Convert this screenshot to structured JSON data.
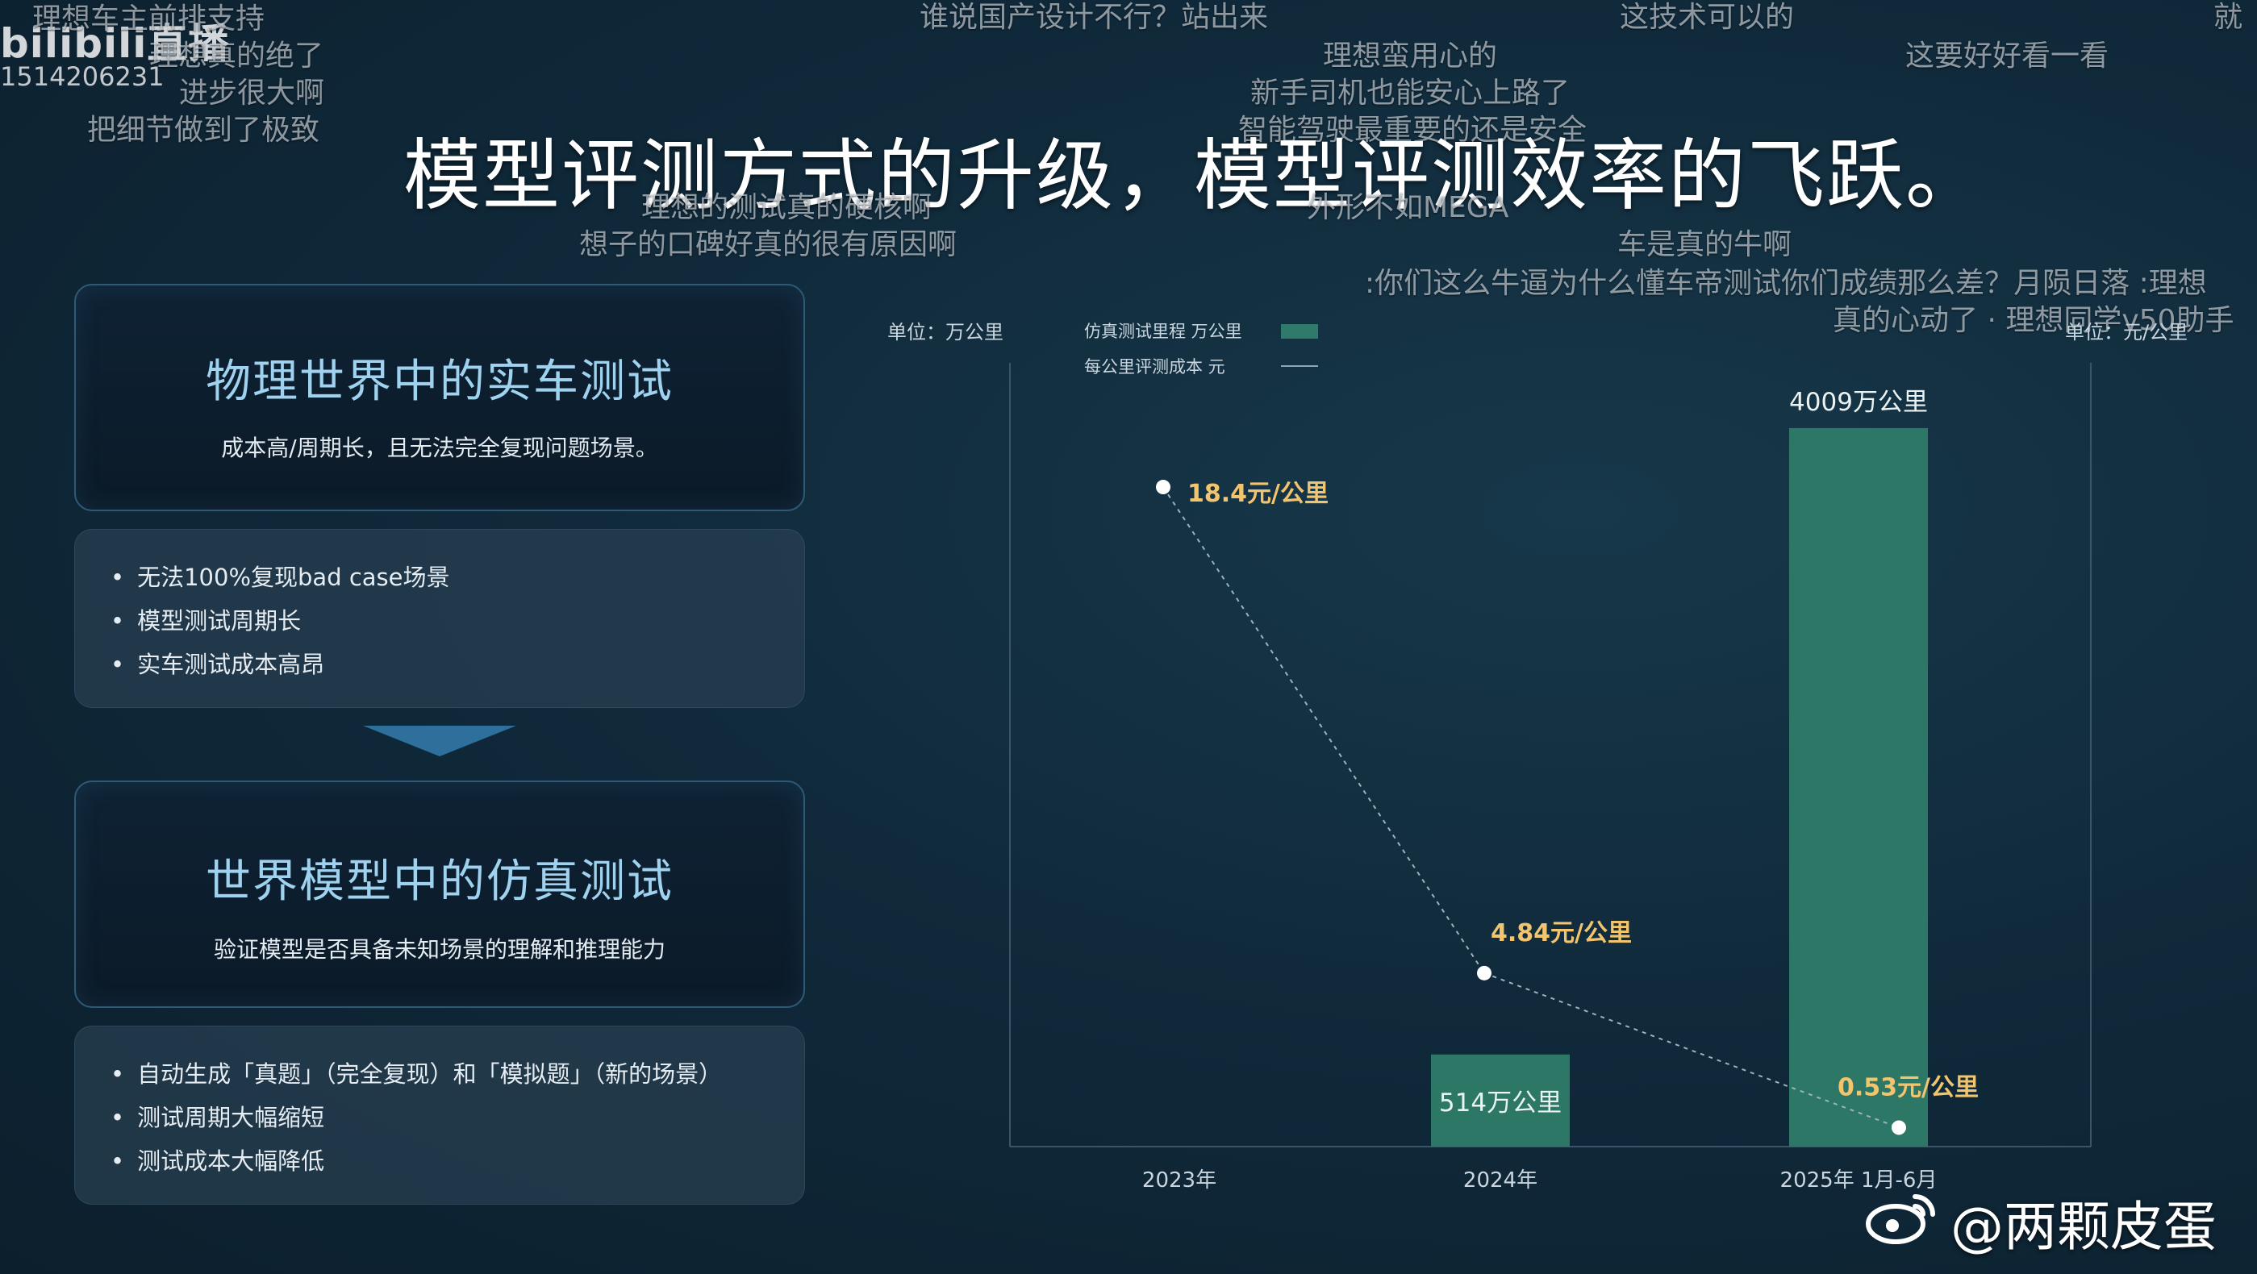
{
  "title": "模型评测方式的升级，模型评测效率的飞跃。",
  "broadcast": {
    "logo": "bilibili直播",
    "room_id": "1514206231"
  },
  "danmaku": [
    {
      "id": "d1",
      "text": "理想车主前排支持"
    },
    {
      "id": "d2",
      "text": "理想真的绝了"
    },
    {
      "id": "d3",
      "text": "进步很大啊"
    },
    {
      "id": "d4",
      "text": "把细节做到了极致"
    },
    {
      "id": "d5",
      "text": "谁说国产设计不行？站出来"
    },
    {
      "id": "d6",
      "text": "理想蛮用心的"
    },
    {
      "id": "d7",
      "text": "新手司机也能安心上路了"
    },
    {
      "id": "d8",
      "text": "智能驾驶最重要的还是安全"
    },
    {
      "id": "d9",
      "text": "这技术可以的"
    },
    {
      "id": "d10",
      "text": "这要好好看一看"
    },
    {
      "id": "d11",
      "text": "就"
    },
    {
      "id": "d12",
      "text": "理想的测试真的硬核啊"
    },
    {
      "id": "d13",
      "text": "想子的口碑好真的很有原因啊"
    },
    {
      "id": "d14",
      "text": "外形不如MEGA"
    },
    {
      "id": "d15",
      "text": "车是真的牛啊"
    },
    {
      "id": "d16",
      "text": ":你们这么牛逼为什么懂车帝测试你们成绩那么差？月陨日落 :理想"
    },
    {
      "id": "d17",
      "text": "真的心动了 · 理想同学v50助手"
    }
  ],
  "left": {
    "card1": {
      "title": "物理世界中的实车测试",
      "subtitle": "成本高/周期长，且无法完全复现问题场景。"
    },
    "list1": [
      "无法100%复现bad case场景",
      "模型测试周期长",
      "实车测试成本高昂"
    ],
    "card2": {
      "title": "世界模型中的仿真测试",
      "subtitle": "验证模型是否具备未知场景的理解和推理能力"
    },
    "list2": [
      "自动生成「真题」（完全复现）和「模拟题」（新的场景）",
      "测试周期大幅缩短",
      "测试成本大幅降低"
    ]
  },
  "chart_data": {
    "type": "bar",
    "left_unit": "单位：万公里",
    "right_unit": "单位：元/公里",
    "legend": [
      {
        "name": "仿真测试里程 万公里",
        "kind": "bar",
        "color": "#2f7a6a"
      },
      {
        "name": "每公里评测成本 元",
        "kind": "line",
        "color": "#8aa6b5"
      }
    ],
    "categories": [
      "2023年",
      "2024年",
      "2025年 1月-6月"
    ],
    "series": [
      {
        "name": "仿真测试里程 万公里",
        "kind": "bar",
        "values": [
          null,
          514,
          4009
        ],
        "labels": [
          "",
          "514万公里",
          "4009万公里"
        ],
        "ylim": [
          0,
          4400
        ]
      },
      {
        "name": "每公里评测成本 元",
        "kind": "line",
        "values": [
          18.4,
          4.84,
          0.53
        ],
        "labels": [
          "18.4元/公里",
          "4.84元/公里",
          "0.53元/公里"
        ],
        "ylim": [
          0,
          22
        ]
      }
    ],
    "colors": {
      "bar": "#2c7765",
      "bar_top": "#3a8f7a",
      "line": "#9bb3c1",
      "point_label": "#f2c46d",
      "axis": "#3c5566",
      "text": "#c9d6df"
    }
  },
  "watermark": "@两颗皮蛋"
}
